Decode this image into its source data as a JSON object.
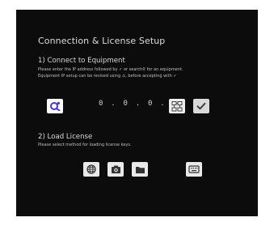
{
  "page": {
    "title": "Connection & License Setup"
  },
  "connect": {
    "heading": "1) Connect to Equipment",
    "line1_a": "Please enter the IP address followed by",
    "line1_sym": "✓",
    "line1_b": "or search",
    "line1_c": "for an equipment.",
    "line2_a": "Equipment IP setup can be revised using",
    "line2_sym": "⚠",
    "line2_b": ", before accepting with",
    "line2_sym2": "✓",
    "ip_value": "0 . 0 . 0 . 0"
  },
  "license": {
    "heading": "2) Load License",
    "desc": "Please select method for loading license keys."
  },
  "icons": {
    "search": "search-icon",
    "topology": "network-topology-icon",
    "accept": "checkmark-icon",
    "web": "globe-icon",
    "camera": "camera-icon",
    "folder": "folder-icon",
    "keyboard": "keyboard-icon"
  },
  "colors": {
    "background": "#0c0c0c",
    "text": "#d6d6d6",
    "button": "#e9e9e9",
    "search_accent": "#4b37c9"
  }
}
